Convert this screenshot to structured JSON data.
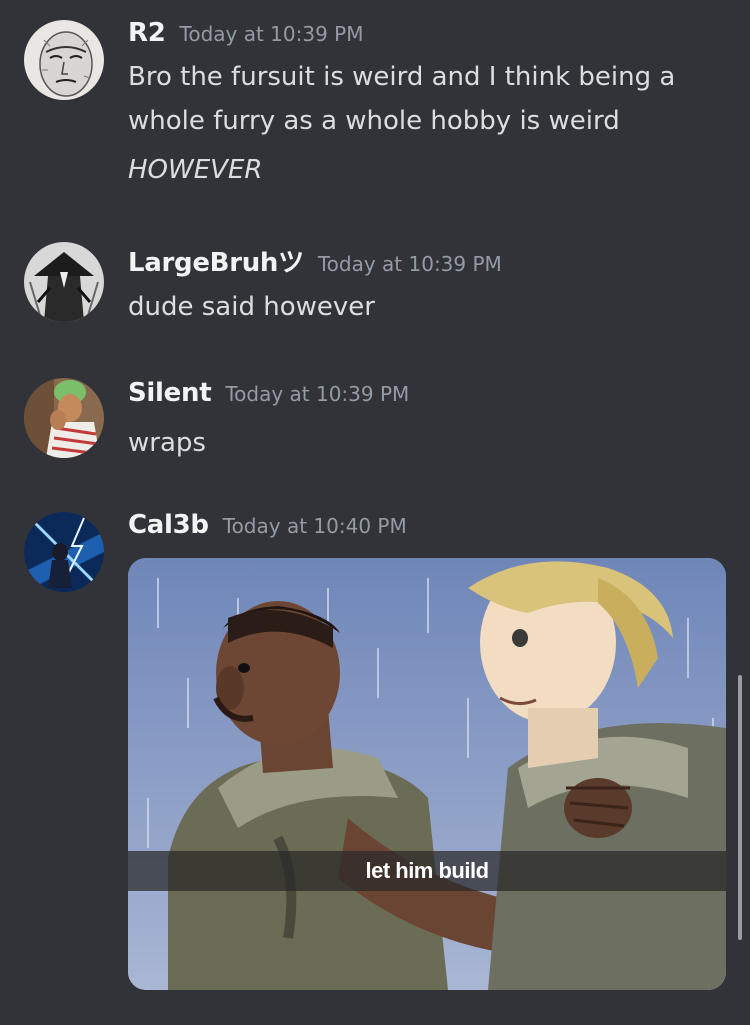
{
  "messages": [
    {
      "username": "R2",
      "timestamp": "Today at 10:39 PM",
      "lines": [
        "Bro the fursuit is weird and I think being a",
        "whole furry as a whole hobby is weird"
      ],
      "extra_italic": "HOWEVER"
    },
    {
      "username": "LargeBruhツ",
      "timestamp": "Today at 10:39 PM",
      "text": "dude said however"
    },
    {
      "username": "Silent",
      "timestamp": "Today at 10:39 PM",
      "text": "wraps"
    },
    {
      "username": "Cal3b",
      "timestamp": "Today at 10:40 PM",
      "attachment": {
        "caption": "let him build"
      }
    }
  ],
  "colors": {
    "background": "#313338",
    "username": "#f2f3f5",
    "timestamp": "#949ba4",
    "text": "#dbdee1"
  }
}
